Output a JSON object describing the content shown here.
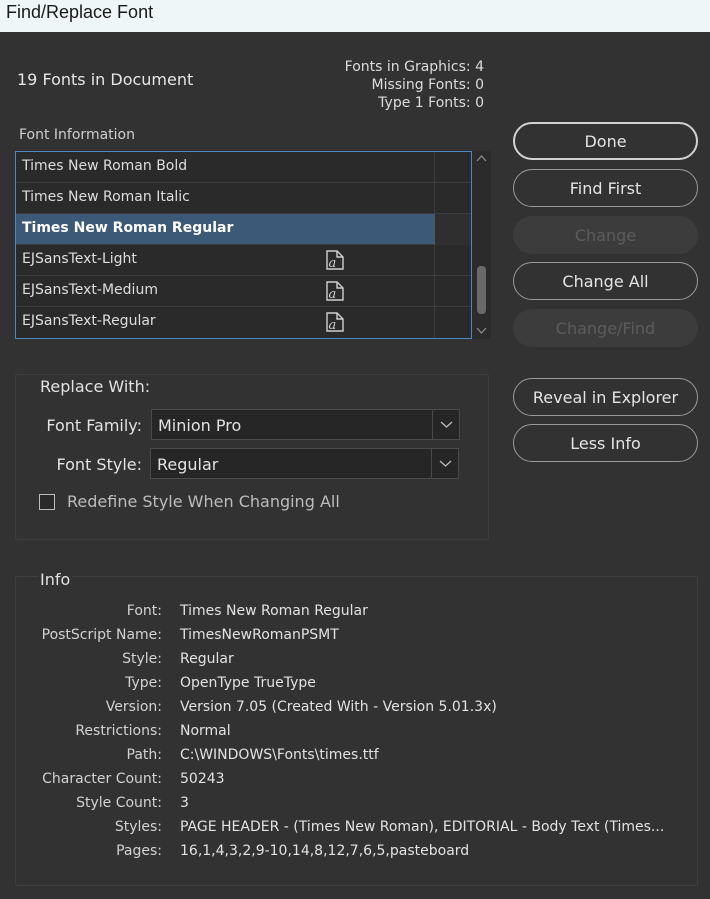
{
  "window": {
    "title": "Find/Replace Font"
  },
  "header": {
    "fonts_in_document": "19 Fonts in Document",
    "fonts_in_graphics": "Fonts in Graphics: 4",
    "missing_fonts": "Missing Fonts: 0",
    "type1_fonts": "Type 1 Fonts: 0"
  },
  "font_list": {
    "label": "Font Information",
    "items": [
      {
        "name": "Times New Roman Bold",
        "icon": "none",
        "selected": false
      },
      {
        "name": "Times New Roman Italic",
        "icon": "none",
        "selected": false
      },
      {
        "name": "Times New Roman Regular",
        "icon": "none",
        "selected": true
      },
      {
        "name": "EJSansText-Light",
        "icon": "font-in-graphic-icon",
        "selected": false
      },
      {
        "name": "EJSansText-Medium",
        "icon": "font-in-graphic-icon",
        "selected": false
      },
      {
        "name": "EJSansText-Regular",
        "icon": "font-in-graphic-icon",
        "selected": false
      }
    ]
  },
  "buttons": {
    "done": "Done",
    "find_first": "Find First",
    "change": "Change",
    "change_all": "Change All",
    "change_find": "Change/Find",
    "reveal": "Reveal in Explorer",
    "less_info": "Less Info"
  },
  "replace_with": {
    "label": "Replace With:",
    "font_family_label": "Font Family:",
    "font_family_value": "Minion Pro",
    "font_style_label": "Font Style:",
    "font_style_value": "Regular",
    "redefine_label": "Redefine Style When Changing All",
    "redefine_checked": false
  },
  "info": {
    "title": "Info",
    "rows": [
      {
        "key": "Font:",
        "value": "Times New Roman Regular"
      },
      {
        "key": "PostScript Name:",
        "value": "TimesNewRomanPSMT"
      },
      {
        "key": "Style:",
        "value": "Regular"
      },
      {
        "key": "Type:",
        "value": "OpenType TrueType"
      },
      {
        "key": "Version:",
        "value": "Version 7.05 (Created With - Version 5.01.3x)"
      },
      {
        "key": "Restrictions:",
        "value": "Normal"
      },
      {
        "key": "Path:",
        "value": "C:\\WINDOWS\\Fonts\\times.ttf"
      },
      {
        "key": "Character Count:",
        "value": "50243"
      },
      {
        "key": "Style Count:",
        "value": "3"
      },
      {
        "key": "Styles:",
        "value": "PAGE HEADER - (Times New Roman), EDITORIAL - Body Text (Times..."
      },
      {
        "key": "Pages:",
        "value": "16,1,4,3,2,9-10,14,8,12,7,6,5,pasteboard"
      }
    ]
  },
  "colors": {
    "background": "#323232",
    "selection": "#3c5a78",
    "list_border": "#4d88c6"
  }
}
